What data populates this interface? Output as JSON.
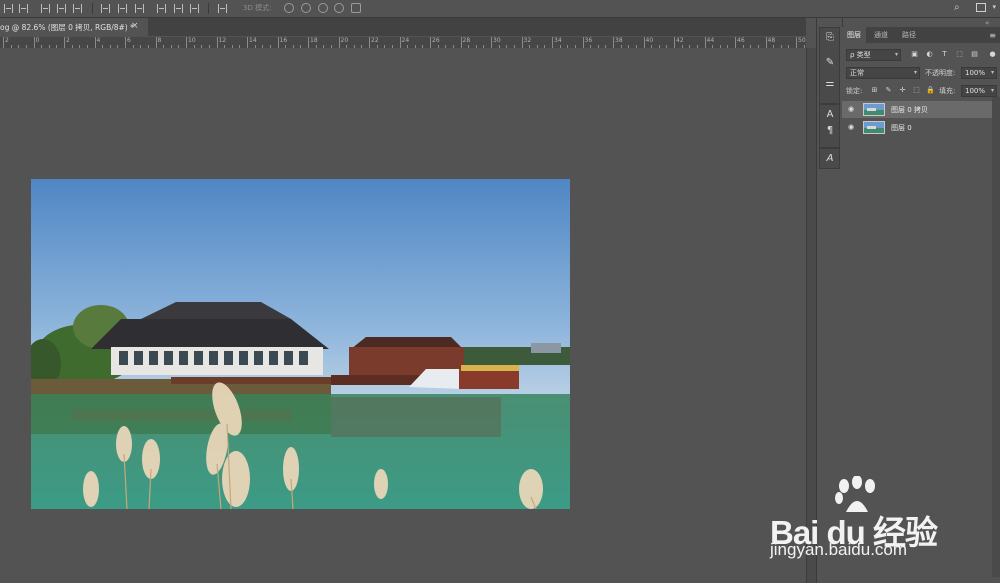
{
  "options_bar": {
    "mode_3d_label": "3D 模式:",
    "icons": [
      "align-left-icon",
      "align-center-icon",
      "align-right-icon",
      "align-top-icon",
      "align-middle-icon",
      "align-bottom-icon",
      "distribute-icon",
      "3d-rotate-icon",
      "3d-roll-icon",
      "3d-pan-icon",
      "3d-slide-icon",
      "3d-scale-icon",
      "search-icon",
      "workspace-icon"
    ]
  },
  "document_tab": {
    "title": "og @ 82.6% (图层 0 拷贝, RGB/8#) *",
    "close": "×"
  },
  "ruler": {
    "labels": [
      "2",
      "0",
      "2",
      "4",
      "6",
      "8",
      "10",
      "12",
      "14",
      "16",
      "18",
      "20",
      "22",
      "24",
      "26",
      "28",
      "30",
      "32",
      "34",
      "36",
      "38",
      "40",
      "42",
      "44",
      "46",
      "48",
      "50"
    ]
  },
  "tool_column": {
    "collapse": "«",
    "tools": [
      "history-brush-icon",
      "brush-icon",
      "adjustments-icon",
      "character-icon",
      "paragraph-icon",
      "glyphs-icon"
    ]
  },
  "layers_panel": {
    "tabs": [
      "图层",
      "通道",
      "路径"
    ],
    "active_tab": "图层",
    "menu": "≡",
    "filter_kind": "ρ 类型",
    "blend_mode": "正常",
    "opacity_label": "不透明度:",
    "opacity_value": "100%",
    "lock_label": "锁定:",
    "fill_label": "填充:",
    "fill_value": "100%",
    "layers": [
      {
        "name": "图层 0 拷贝",
        "selected": true,
        "visible": true
      },
      {
        "name": "图层 0",
        "selected": false,
        "visible": true
      }
    ]
  },
  "watermark": {
    "brand": "Bai du 经验",
    "url": "jingyan.baidu.com"
  },
  "colors": {
    "ui_bg": "#535353",
    "panel_dark": "#424242",
    "selected_layer": "#6a6a6a",
    "sky": "#5b8fc9",
    "water": "#3f8f74"
  }
}
